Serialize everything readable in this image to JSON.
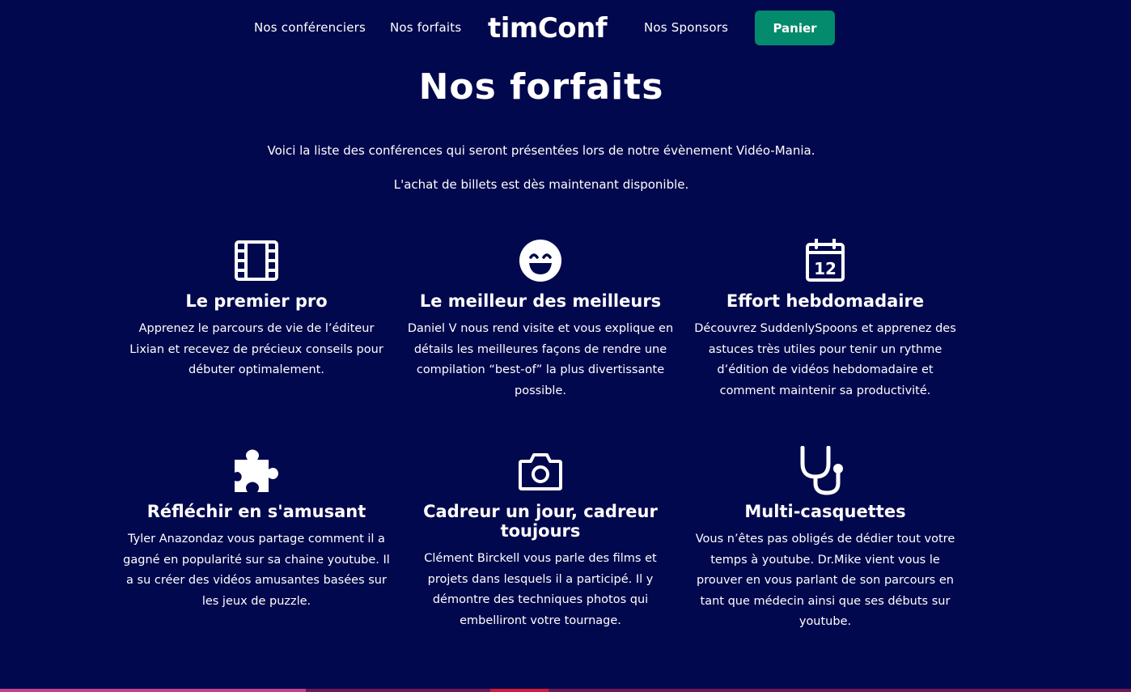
{
  "nav": {
    "speakers_label": "Nos conférenciers",
    "packages_label": "Nos forfaits",
    "logo_text": "timConf",
    "sponsors_label": "Nos Sponsors",
    "cart_label": "Panier"
  },
  "page": {
    "title": "Nos forfaits",
    "intro_line1": "Voici la liste des conférences qui seront présentées lors de notre évènement Vidéo-Mania.",
    "intro_line2": "L'achat de billets est dès maintenant disponible."
  },
  "cards": [
    {
      "icon": "film-icon",
      "title": "Le premier pro",
      "text": "Apprenez le parcours de vie de l’éditeur Lixian et recevez de précieux conseils pour débuter optimalement."
    },
    {
      "icon": "laughing-face-icon",
      "title": "Le meilleur des meilleurs",
      "text": "Daniel V nous rend visite et vous explique en détails les meilleures façons de rendre une compilation “best-of” la plus divertissante possible."
    },
    {
      "icon": "calendar-icon",
      "icon_text": "12",
      "title": "Effort hebdomadaire",
      "text": "Découvrez SuddenlySpoons et apprenez des astuces très utiles pour tenir un rythme d’édition de vidéos hebdomadaire et comment maintenir sa productivité."
    },
    {
      "icon": "puzzle-piece-icon",
      "title": "Réfléchir en s'amusant",
      "text": "Tyler Anazondaz vous partage comment il a gagné en popularité sur sa chaine youtube. Il a su créer des vidéos amusantes basées sur les jeux de puzzle."
    },
    {
      "icon": "camera-icon",
      "title": "Cadreur un jour, cadreur toujours",
      "text": "Clément Birckell vous parle des films et projets dans lesquels il a participé. Il y démontre des techniques photos qui embelliront votre tournage."
    },
    {
      "icon": "stethoscope-icon",
      "title": "Multi-casquettes",
      "text": "Vous n’êtes pas obligés de dédier tout votre temps à youtube. Dr.Mike vient vous le prouver en vous parlant de son parcours en tant que médecin ainsi que ses débuts sur youtube."
    }
  ],
  "colors": {
    "background": "#02084d",
    "accent": "#048a6c",
    "text": "#ffffff",
    "bar_pink": "#c2408f",
    "bar_dark": "#6b1a55",
    "bar_red": "#d01c3c"
  }
}
